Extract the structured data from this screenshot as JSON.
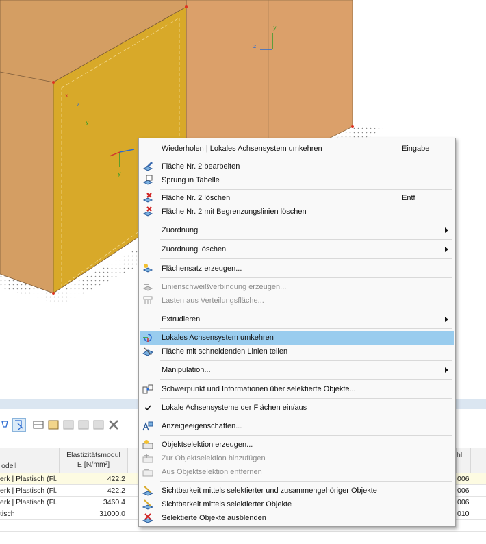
{
  "viewport": {
    "axis_labels": {
      "y_top": "y",
      "z_top": "z",
      "x_face": "x",
      "y_face": "y",
      "z_face": "z",
      "y_face2": "y"
    }
  },
  "table": {
    "headers": {
      "modell": "odell",
      "emod_line1": "Elastizitätsmodul",
      "emod_line2": "E [N/mm²]",
      "last": "hl"
    },
    "rows": [
      {
        "modell": "erk | Plastisch (Fl...",
        "emod": "422.2",
        "last": "006"
      },
      {
        "modell": "erk | Plastisch (Fl...",
        "emod": "422.2",
        "last": "006"
      },
      {
        "modell": "erk | Plastisch (Fl...",
        "emod": "3460.4",
        "last": "006"
      },
      {
        "modell": "tisch",
        "emod": "31000.0",
        "last": "010"
      }
    ]
  },
  "menu": {
    "items": [
      {
        "label": "Wiederholen | Lokales Achsensystem umkehren",
        "shortcut": "Eingabe",
        "icon": "none"
      },
      {
        "label": "Fläche Nr. 2 bearbeiten",
        "icon": "edit-surface-icon"
      },
      {
        "label": "Sprung in Tabelle",
        "icon": "table-jump-icon"
      },
      {
        "label": "Fläche Nr. 2 löschen",
        "shortcut": "Entf",
        "icon": "delete-surface-icon"
      },
      {
        "label": "Fläche Nr. 2 mit Begrenzungslinien löschen",
        "icon": "delete-surface-lines-icon"
      },
      {
        "label": "Zuordnung",
        "icon": "none"
      },
      {
        "label": "Zuordnung löschen",
        "icon": "none"
      },
      {
        "label": "Flächensatz erzeugen...",
        "icon": "surface-set-icon"
      },
      {
        "label": "Linienschweißverbindung erzeugen...",
        "icon": "weld-icon"
      },
      {
        "label": "Lasten aus Verteilungsfläche...",
        "icon": "load-distribution-icon"
      },
      {
        "label": "Extrudieren",
        "icon": "none"
      },
      {
        "label": "Lokales Achsensystem umkehren",
        "icon": "reverse-axes-icon"
      },
      {
        "label": "Fläche mit schneidenden Linien teilen",
        "icon": "split-surface-icon"
      },
      {
        "label": "Manipulation...",
        "icon": "none"
      },
      {
        "label": "Schwerpunkt und Informationen über selektierte Objekte...",
        "icon": "centroid-info-icon"
      },
      {
        "label": "Lokale Achsensysteme der Flächen ein/aus",
        "icon": "checkmark-icon"
      },
      {
        "label": "Anzeigeeigenschaften...",
        "icon": "display-properties-icon"
      },
      {
        "label": "Objektselektion erzeugen...",
        "icon": "create-selection-icon"
      },
      {
        "label": "Zur Objektselektion hinzufügen",
        "icon": "add-selection-icon"
      },
      {
        "label": "Aus Objektselektion entfernen",
        "icon": "remove-selection-icon"
      },
      {
        "label": "Sichtbarkeit mittels selektierter und zusammengehöriger Objekte",
        "icon": "visibility-related-icon"
      },
      {
        "label": "Sichtbarkeit mittels selektierter Objekte",
        "icon": "visibility-selected-icon"
      },
      {
        "label": "Selektierte Objekte ausblenden",
        "icon": "hide-selected-icon"
      }
    ]
  },
  "colors": {
    "box_front": "#d49e63",
    "box_side_highlight": "#d9a64a",
    "box_selected": "#d8a929",
    "menu_highlight": "#99ccee",
    "panel_header": "#dbe6f1"
  }
}
